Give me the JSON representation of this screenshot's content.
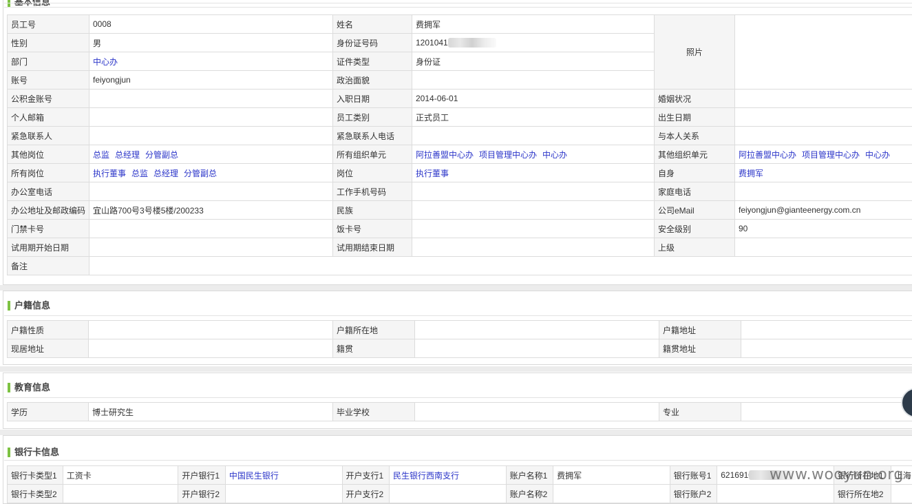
{
  "basic": {
    "title": "基本信息",
    "employee_no_label": "员工号",
    "employee_no": "0008",
    "name_label": "姓名",
    "name": "费拥军",
    "photo_label": "照片",
    "gender_label": "性别",
    "gender": "男",
    "id_no_label": "身份证号码",
    "id_no": "12010419",
    "dept_label": "部门",
    "dept": "中心办",
    "id_type_label": "证件类型",
    "id_type": "身份证",
    "account_label": "账号",
    "account": "feiyongjun",
    "political_label": "政治面貌",
    "political": "",
    "fund_label": "公积金账号",
    "fund": "",
    "join_date_label": "入职日期",
    "join_date": "2014-06-01",
    "marital_label": "婚姻状况",
    "marital": "",
    "email_personal_label": "个人邮箱",
    "email_personal": "",
    "emp_type_label": "员工类别",
    "emp_type": "正式员工",
    "birth_label": "出生日期",
    "birth": "",
    "emergency_label": "紧急联系人",
    "emergency": "",
    "emergency_phone_label": "紧急联系人电话",
    "emergency_phone": "",
    "relation_label": "与本人关系",
    "relation": "",
    "other_posts_label": "其他岗位",
    "other_posts": [
      "总监",
      "总经理",
      "分管副总"
    ],
    "all_units_label": "所有组织单元",
    "all_units": [
      "阿拉善盟中心办",
      "项目管理中心办",
      "中心办"
    ],
    "other_units_label": "其他组织单元",
    "other_units": [
      "阿拉善盟中心办",
      "项目管理中心办",
      "中心办"
    ],
    "all_posts_label": "所有岗位",
    "all_posts": [
      "执行董事",
      "总监",
      "总经理",
      "分管副总"
    ],
    "post_label": "岗位",
    "post": "执行董事",
    "self_label": "自身",
    "self": "费拥军",
    "office_phone_label": "办公室电话",
    "office_phone": "",
    "mobile_label": "工作手机号码",
    "mobile": "",
    "home_phone_label": "家庭电话",
    "home_phone": "",
    "office_addr_label": "办公地址及邮政编码",
    "office_addr": "宜山路700号3号楼5楼/200233",
    "ethnic_label": "民族",
    "ethnic": "",
    "company_email_label": "公司eMail",
    "company_email": "feiyongjun@gianteenergy.com.cn",
    "door_card_label": "门禁卡号",
    "door_card": "",
    "meal_card_label": "饭卡号",
    "meal_card": "",
    "security_label": "安全级别",
    "security": "90",
    "trial_start_label": "试用期开始日期",
    "trial_start": "",
    "trial_end_label": "试用期结束日期",
    "trial_end": "",
    "superior_label": "上级",
    "superior": "",
    "remark_label": "备注",
    "remark": ""
  },
  "household": {
    "title": "户籍信息",
    "nature_label": "户籍性质",
    "nature": "",
    "location_label": "户籍所在地",
    "location": "",
    "address_label": "户籍地址",
    "address": "",
    "current_label": "现居地址",
    "current": "",
    "native_label": "籍贯",
    "native": "",
    "native_addr_label": "籍贯地址",
    "native_addr": ""
  },
  "education": {
    "title": "教育信息",
    "degree_label": "学历",
    "degree": "博士研究生",
    "school_label": "毕业学校",
    "school": "",
    "major_label": "专业",
    "major": ""
  },
  "bank": {
    "title": "银行卡信息",
    "rows": [
      {
        "type_label": "银行卡类型1",
        "type": "工资卡",
        "bank_label": "开户银行1",
        "bank": "中国民生银行",
        "branch_label": "开户支行1",
        "branch": "民生银行西南支行",
        "holder_label": "账户名称1",
        "holder": "费拥军",
        "acct_label": "银行账号1",
        "acct": "6216910",
        "city_label": "银行所在地1",
        "city": "上海"
      },
      {
        "type_label": "银行卡类型2",
        "type": "",
        "bank_label": "开户银行2",
        "bank": "",
        "branch_label": "开户支行2",
        "branch": "",
        "holder_label": "账户名称2",
        "holder": "",
        "acct_label": "银行账户2",
        "acct": "",
        "city_label": "银行所在地2",
        "city": ""
      }
    ]
  },
  "watermark": "www.wooyun.org",
  "colors": {
    "label_bg": "#f5f5f5",
    "link": "#2b35c9",
    "section_bar": "#7dc242"
  }
}
